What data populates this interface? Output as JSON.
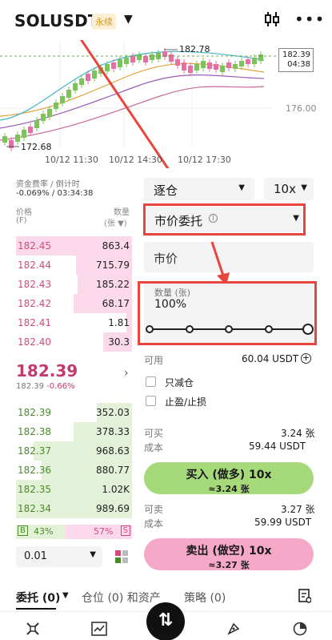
{
  "header": {
    "symbol": "SOLUSDT",
    "badge": "永续",
    "caret": "▼"
  },
  "chart": {
    "high_label": "182.78",
    "low_label": "172.68",
    "price_tag": "182.39",
    "countdown": "04:38",
    "axis_price": "176.00",
    "times": [
      "10/12 11:30",
      "10/12 14:30",
      "10/12 17:30"
    ]
  },
  "orderbook": {
    "funding_label": "资金费率 / 倒计时",
    "funding_value": "-0.069% / 03:34:38",
    "price_head": "价格",
    "price_unit": "(F)",
    "qty_head": "数量",
    "qty_unit": "(张 ▼)",
    "asks": [
      {
        "price": "182.45",
        "qty": "863.4"
      },
      {
        "price": "182.44",
        "qty": "715.79"
      },
      {
        "price": "182.43",
        "qty": "185.22"
      },
      {
        "price": "182.42",
        "qty": "68.17"
      },
      {
        "price": "182.41",
        "qty": "1.81"
      },
      {
        "price": "182.40",
        "qty": "30.3"
      }
    ],
    "depth_fill": {
      "asks": [
        1.0,
        0.48,
        0.47,
        0.5,
        0.05,
        0.25
      ],
      "bids": [
        0.3,
        0.5,
        0.85,
        0.78,
        1.0,
        1.0
      ]
    },
    "last_price": "182.39",
    "last_sub_price": "182.39",
    "last_change": "-0.66%",
    "bids": [
      {
        "price": "182.39",
        "qty": "352.03"
      },
      {
        "price": "182.38",
        "qty": "378.33"
      },
      {
        "price": "182.37",
        "qty": "968.63"
      },
      {
        "price": "182.36",
        "qty": "880.77"
      },
      {
        "price": "182.35",
        "qty": "1.02K"
      },
      {
        "price": "182.34",
        "qty": "989.69"
      }
    ],
    "buy_ratio_tag": "B",
    "buy_ratio": "43%",
    "sell_ratio": "57%",
    "sell_ratio_tag": "S",
    "buy_fraction": 0.43,
    "precision": "0.01"
  },
  "form": {
    "margin_mode": "逐仓",
    "leverage": "10x",
    "order_type": "市价委托",
    "price_placeholder": "市价",
    "qty_label": "数量 (张)",
    "qty_value": "100%",
    "slider_fraction": 1.0,
    "available_label": "可用",
    "available_value": "60.04 USDT",
    "reduce_only": "只减仓",
    "tp_sl": "止盈/止损",
    "can_buy_label": "可买",
    "can_buy_value": "3.24 张",
    "cost_label": "成本",
    "buy_cost": "59.44 USDT",
    "buy_button": "买入 (做多) 10x",
    "buy_sub": "≈3.24 张",
    "can_sell_label": "可卖",
    "can_sell_value": "3.27 张",
    "sell_cost": "59.99 USDT",
    "sell_button": "卖出 (做空) 10x",
    "sell_sub": "≈3.27 张"
  },
  "tabs": {
    "orders": "委托 (0)",
    "positions": "仓位 (0) 和资产",
    "strategy": "策略 (0)"
  },
  "colors": {
    "ask": "#d34b7d",
    "bid": "#4a8a2a",
    "annotation": "#e8453c",
    "buy_button": "#a6d97a",
    "sell_button": "#f6a8c8"
  }
}
